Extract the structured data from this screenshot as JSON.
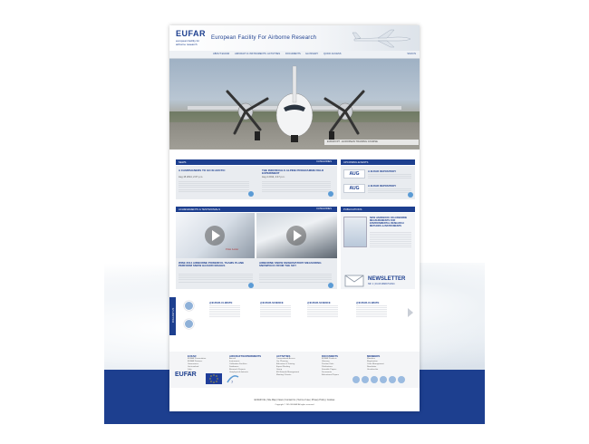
{
  "header": {
    "logo_text": "EUFAR",
    "logo_subtext": "european facility for airborne research",
    "title": "European Facility For Airborne Research"
  },
  "nav": {
    "items": [
      "ABOUT EUFAR",
      "AIRCRAFT & INSTRUMENTS",
      "ACTIVITIES",
      "DOCUMENTS",
      "GLOSSARY",
      "QUICK ACCESS"
    ],
    "login": "SIGN IN"
  },
  "hero": {
    "caption": "EUFAR FP7 - EUROPEAN TRAINING COURSE"
  },
  "news": {
    "header": "NEWS",
    "categories_label": "CATEGORIES",
    "items": [
      {
        "title": "A CAMPAIGNERS TO GO IN ARCTIC",
        "date": "Aug 15 2014, 2:07 p.m."
      },
      {
        "title": "THE INDIVIDUALS ALPINE PROGRAMME FIELD EXPERIMENT",
        "date": "Aug 4 2014, 2:47 p.m."
      }
    ]
  },
  "events": {
    "header": "UPCOMING EVENTS",
    "items": [
      {
        "tag": "AUG",
        "title": "A EUFAR REPOSITORY"
      },
      {
        "tag": "AUG",
        "title": "A EUFAR REPOSITORY"
      }
    ]
  },
  "achievements": {
    "header": "ACHIEVEMENTS & TESTIMONIALS",
    "categories_label": "CATEGORIES",
    "video_caption": "Eliza Lasko",
    "items": [
      {
        "title": "WISE 2014 AIRBORNE POWERFUL TEAMS PLANE PERFORM SNOW HAZARD IMAGES"
      },
      {
        "title": "AIRBORNE SNOW OBSERVATORY MEASURING SNOWPACK FROM THE SKY"
      }
    ]
  },
  "publications": {
    "header": "PUBLICATIONS",
    "book_title": "NEW HANDBOOK ON AIRBORNE MEASUREMENTS FOR ENVIRONMENTAL RESEARCH METHODS & INSTRUMENTS",
    "newsletter_title": "NEWSLETTER",
    "newsletter_sub": "NR. 1 | 01.03 MARCH 2014"
  },
  "social": {
    "follow_label": "FOLLOW US",
    "tweets": [
      {
        "title": "@EUFAR-CLIMATE"
      },
      {
        "title": "@EUFAR-SCIENCE"
      },
      {
        "title": "@EUFAR-SCIENCE"
      },
      {
        "title": "@EUFAR-CLIMATE"
      }
    ]
  },
  "footer": {
    "columns": [
      {
        "title": "EUFAR",
        "links": [
          "EUFAR Presentation",
          "EUFAR Partners",
          "Governance",
          "Get involved",
          "Jobs",
          "Links",
          "FAQ"
        ]
      },
      {
        "title": "AIRCRAFT/EXPERIMENTS",
        "links": [
          "Aircraft",
          "Instruments",
          "Calibration Facilities",
          "Databases",
          "Research Projects",
          "Geophysical datasets"
        ]
      },
      {
        "title": "ACTIVITIES",
        "links": [
          "Transnational Access",
          "Op. Planning",
          "Education & Training",
          "Expert Working",
          "Group",
          "EU Network Management",
          "Meeting / Events"
        ]
      },
      {
        "title": "DOCUMENTS",
        "links": [
          "EUFAR Products",
          "Glossary",
          "Position Units",
          "Publications",
          "Scientific Papers",
          "Documents",
          "Educational Papers"
        ]
      },
      {
        "title": "MEMBERS",
        "links": [
          "Members",
          "Registration",
          "Cube Management",
          "Newsletter",
          "Unsubscribe"
        ]
      }
    ],
    "bottom_links": "EUFAR Info  |  Site Map  |  News  |  Contact Us  |  Terms of use  |  Privacy Policy  |  Cookies",
    "copyright": "Copyright © 2014 EUFAR All rights reserved"
  },
  "colors": {
    "brand": "#1d3f8f",
    "accent": "#5b9bd5"
  }
}
